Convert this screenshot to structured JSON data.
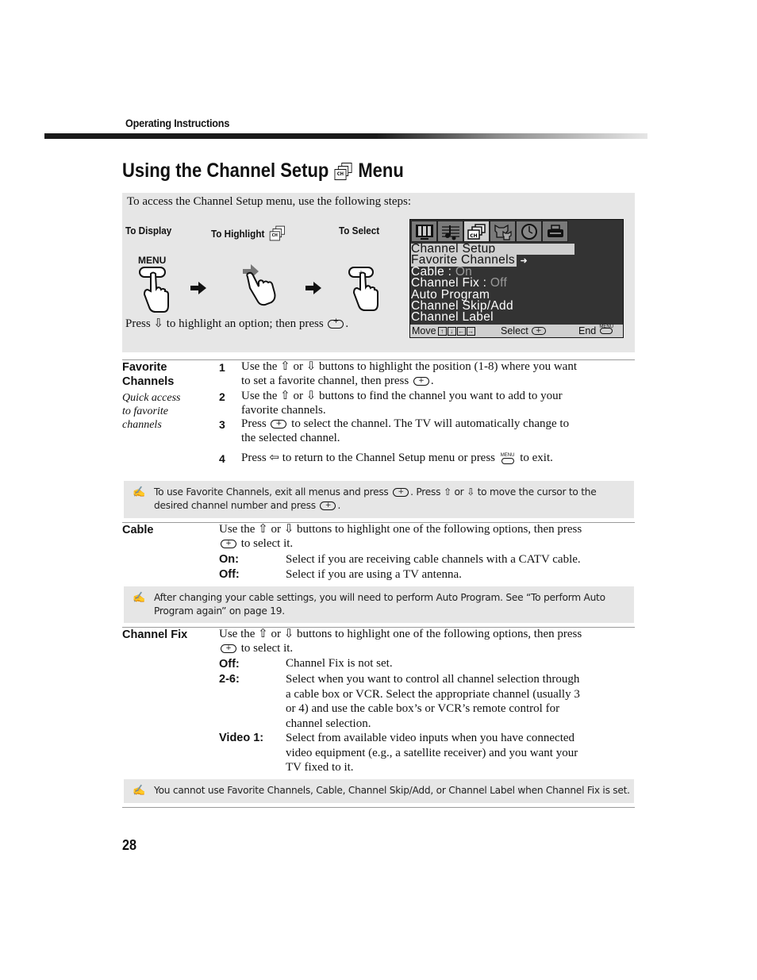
{
  "header": {
    "running_head": "Operating Instructions",
    "title_pre": "Using the Channel Setup",
    "title_icon": "channel-setup-icon",
    "title_post": "Menu"
  },
  "access": {
    "intro": "To access the Channel Setup menu, use the following steps:",
    "steps": [
      {
        "label": "To Display",
        "button": "MENU",
        "icon": "hand-press-menu-icon"
      },
      {
        "label": "To Highlight",
        "icon": "hand-press-arrow-icon"
      },
      {
        "label": "To Select",
        "icon": "hand-press-select-icon"
      }
    ],
    "hint_pre": "Press",
    "hint_mid": "to highlight an option; then press",
    "hint_post": "."
  },
  "osd": {
    "tabs": [
      "video-icon",
      "audio-icon",
      "channel-icon",
      "parent-icon",
      "timer-icon",
      "setup-icon"
    ],
    "active_tab": 2,
    "title": "Channel Setup",
    "items": [
      {
        "label": "Favorite Channels",
        "value": "",
        "highlighted": true
      },
      {
        "label": "Cable : ",
        "value": "On"
      },
      {
        "label": "Channel Fix : ",
        "value": "Off"
      },
      {
        "label": "Auto Program",
        "value": ""
      },
      {
        "label": "Channel Skip/Add",
        "value": ""
      },
      {
        "label": "Channel Label",
        "value": ""
      }
    ],
    "footer": {
      "move": "Move",
      "select": "Select",
      "end": "End",
      "menu_small": "MENU"
    },
    "colors": {
      "background": "#333333",
      "highlight": "#cfcfcf",
      "value": "#9a9a9a"
    }
  },
  "favorite": {
    "label_1": "Favorite",
    "label_2": "Channels",
    "sub_1": "Quick access",
    "sub_2": "to favorite",
    "sub_3": "channels",
    "steps": [
      {
        "n": "1",
        "a": "Use the ⇧ or ⇩ buttons to highlight the position (1-8) where you want",
        "b": "to set a favorite channel, then press",
        "c": "."
      },
      {
        "n": "2",
        "a": "Use the ⇧ or ⇩ buttons to find the channel you want to add to your",
        "b": "favorite channels."
      },
      {
        "n": "3",
        "a": "to select the channel. The TV will automatically change to",
        "a_pre": "Press",
        "b": "the selected channel."
      },
      {
        "n": "4",
        "a_pre": "Press ⇦ to return to the Channel Setup menu or press",
        "a": "to exit."
      }
    ],
    "note_a": "To use Favorite Channels, exit all menus and press",
    "note_b": ". Press ⇧ or ⇩ to move the cursor to the",
    "note_c": "desired channel number and press",
    "note_d": "."
  },
  "cable": {
    "label": "Cable",
    "intro_a": "Use the ⇧ or ⇩ buttons to highlight one of the following options, then press",
    "intro_b": "to select it.",
    "options": [
      {
        "key": "On:",
        "text": "Select if you are receiving cable channels with a CATV cable."
      },
      {
        "key": "Off:",
        "text": "Select if you are using a TV antenna."
      }
    ],
    "note_a": "After changing your cable settings, you will need to perform Auto Program. See “To perform Auto",
    "note_b": "Program again” on page 19."
  },
  "channel_fix": {
    "label": "Channel Fix",
    "intro_a": "Use the ⇧ or ⇩ buttons to highlight one of the following options, then press",
    "intro_b": "to select it.",
    "options": [
      {
        "key": "Off:",
        "lines": [
          "Channel Fix is not set."
        ]
      },
      {
        "key": "2-6:",
        "lines": [
          "Select when you want to control all channel selection through",
          "a cable box or VCR. Select the appropriate channel (usually 3",
          "or 4) and use the cable box’s or VCR’s remote control for",
          "channel selection."
        ]
      },
      {
        "key": "Video 1:",
        "lines": [
          "Select from available video inputs when you have connected",
          "video equipment (e.g., a satellite receiver) and you want your",
          "TV fixed to it."
        ]
      }
    ],
    "note": "You cannot use Favorite Channels, Cable, Channel Skip/Add, or Channel Label when Channel Fix is set."
  },
  "footer": {
    "page_number": "28"
  }
}
